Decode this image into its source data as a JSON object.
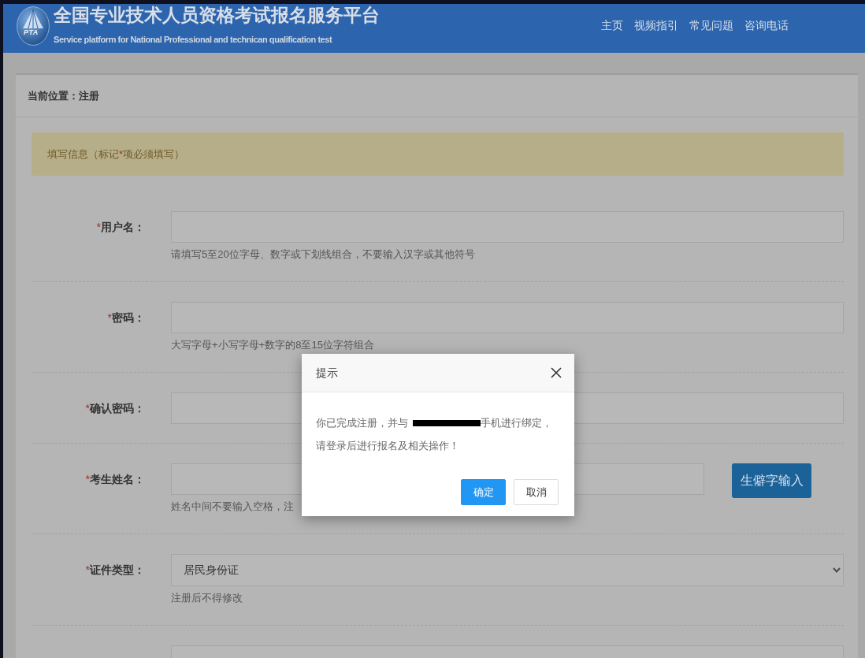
{
  "header": {
    "logo_text": "PTA",
    "title": "全国专业技术人员资格考试报名服务平台",
    "subtitle": "Service platform for National Professional and technican qualification test",
    "nav": [
      "主页",
      "视频指引",
      "常见问题",
      "咨询电话"
    ]
  },
  "breadcrumb": "当前位置：注册",
  "notice": {
    "text_before": "填写信息（标记",
    "mark": "*",
    "text_after": "项必须填写）"
  },
  "form": {
    "fields": [
      {
        "kind": "text",
        "mark": "*",
        "label": "用户名：",
        "hint": "请填写5至20位字母、数字或下划线组合，不要输入汉字或其他符号"
      },
      {
        "kind": "text",
        "mark": "*",
        "label": "密码：",
        "hint": "大写字母+小写字母+数字的8至15位字符组合"
      },
      {
        "kind": "text",
        "mark": "*",
        "label": "确认密码："
      },
      {
        "kind": "text_with_button",
        "mark": "*",
        "label": "考生姓名：",
        "hint": "姓名中间不要输入空格，注",
        "button": "生僻字输入"
      },
      {
        "kind": "select",
        "mark": "*",
        "label": "证件类型：",
        "value": "居民身份证",
        "hint": "注册后不得修改"
      },
      {
        "kind": "text"
      }
    ]
  },
  "dialog": {
    "title": "提示",
    "message_lines": [
      {
        "text_before": "你已完成注册，并与",
        "redacted": true,
        "text_after": "手机进行绑定，"
      },
      {
        "text_before": "请登录后进行报名及相关操作！",
        "redacted": false
      }
    ],
    "buttons": [
      {
        "kind": "primary",
        "label": "确定"
      },
      {
        "kind": "default",
        "label": "取消"
      }
    ]
  }
}
